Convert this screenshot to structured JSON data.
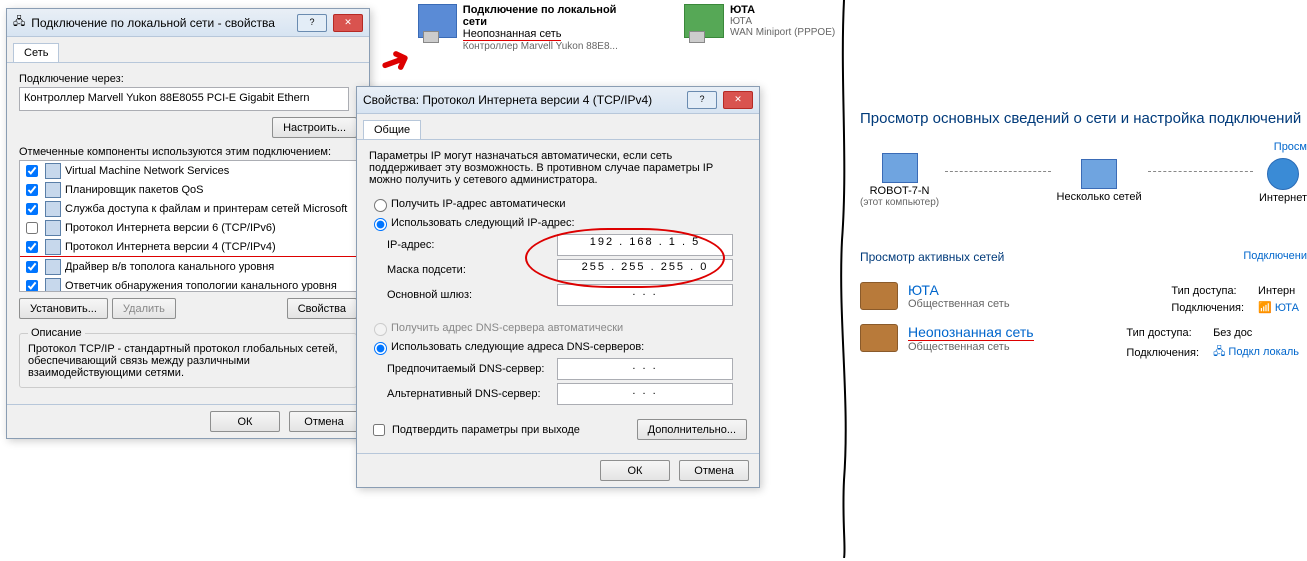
{
  "task": {
    "lan": {
      "title": "Подключение по локальной сети",
      "status": "Неопознанная сеть",
      "device": "Контроллер Marvell Yukon 88E8..."
    },
    "yota": {
      "title": "ЮТА",
      "status": "ЮТА",
      "device": "WAN Miniport (PPPOE)"
    }
  },
  "propWin": {
    "title": "Подключение по локальной сети - свойства",
    "tab": "Сеть",
    "connectVia": "Подключение через:",
    "adapter": "Контроллер Marvell Yukon 88E8055 PCI-E Gigabit Ethern",
    "configure": "Настроить...",
    "componentsLbl": "Отмеченные компоненты используются этим подключением:",
    "items": [
      {
        "c": true,
        "n": "Virtual Machine Network Services"
      },
      {
        "c": true,
        "n": "Планировщик пакетов QoS"
      },
      {
        "c": true,
        "n": "Служба доступа к файлам и принтерам сетей Microsoft"
      },
      {
        "c": false,
        "n": "Протокол Интернета версии 6 (TCP/IPv6)"
      },
      {
        "c": true,
        "n": "Протокол Интернета версии 4 (TCP/IPv4)",
        "hl": true
      },
      {
        "c": true,
        "n": "Драйвер в/в тополога канального уровня"
      },
      {
        "c": true,
        "n": "Ответчик обнаружения топологии канального уровня"
      }
    ],
    "install": "Установить...",
    "remove": "Удалить",
    "props": "Свойства",
    "descLbl": "Описание",
    "desc": "Протокол TCP/IP - стандартный протокол глобальных сетей, обеспечивающий связь между различными взаимодействующими сетями.",
    "ok": "ОК",
    "cancel": "Отмена"
  },
  "ipWin": {
    "title": "Свойства: Протокол Интернета версии 4 (TCP/IPv4)",
    "tab": "Общие",
    "info": "Параметры IP могут назначаться автоматически, если сеть поддерживает эту возможность. В противном случае параметры IP можно получить у сетевого администратора.",
    "optAuto": "Получить IP-адрес автоматически",
    "optManual": "Использовать следующий IP-адрес:",
    "ipLbl": "IP-адрес:",
    "ip": "192 . 168 .  1  .  5",
    "maskLbl": "Маска подсети:",
    "mask": "255 . 255 . 255 .  0",
    "gwLbl": "Основной шлюз:",
    "gw": ".        .        .",
    "dnsAuto": "Получить адрес DNS-сервера автоматически",
    "dnsManual": "Использовать следующие адреса DNS-серверов:",
    "dns1Lbl": "Предпочитаемый DNS-сервер:",
    "dns1": ".        .        .",
    "dns2Lbl": "Альтернативный DNS-сервер:",
    "dns2": ".        .        .",
    "validate": "Подтвердить параметры при выходе",
    "advanced": "Дополнительно...",
    "ok": "ОК",
    "cancel": "Отмена"
  },
  "right": {
    "heading": "Просмотр основных сведений о сети и настройка подключений",
    "fullmap": "Просм",
    "node1": "ROBOT-7-N",
    "node1s": "(этот компьютер)",
    "node2": "Несколько сетей",
    "node3": "Интернет",
    "activeLbl": "Просмотр активных сетей",
    "connLbl": "Подключени",
    "net1": {
      "name": "ЮТА",
      "type": "Общественная сеть",
      "accessLbl": "Тип доступа:",
      "access": "Интерн",
      "connLbl": "Подключения:",
      "conn": "ЮТА"
    },
    "net2": {
      "name": "Неопознанная сеть",
      "type": "Общественная сеть",
      "accessLbl": "Тип доступа:",
      "access": "Без дос",
      "connLbl": "Подключения:",
      "conn": "Подкл локаль"
    }
  }
}
